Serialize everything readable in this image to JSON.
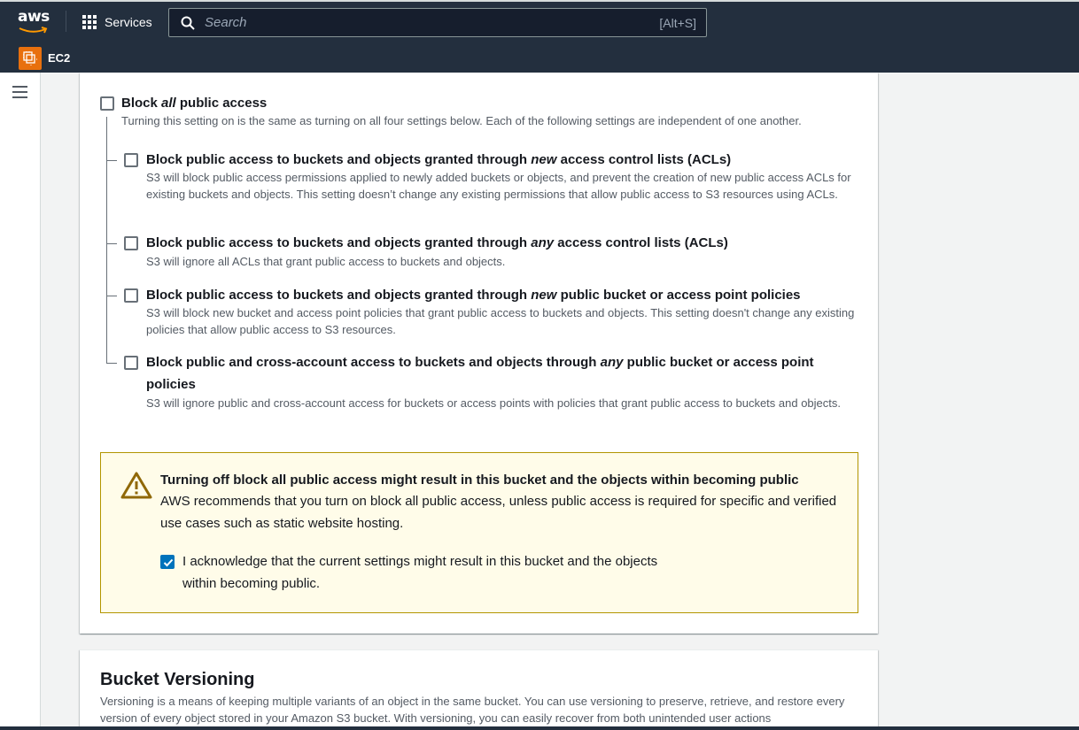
{
  "topbar": {
    "logo_text": "aws",
    "services_label": "Services",
    "search_placeholder": "Search",
    "search_shortcut": "[Alt+S]",
    "service_name": "EC2",
    "colors": {
      "background": "#232f3e",
      "ec2_icon": "#e8700e"
    }
  },
  "block_public_access": {
    "master": {
      "title_prefix": "Block ",
      "title_em": "all",
      "title_suffix": " public access",
      "description": "Turning this setting on is the same as turning on all four settings below. Each of the following settings are independent of one another.",
      "checked": false
    },
    "options": [
      {
        "title_prefix": "Block public access to buckets and objects granted through ",
        "title_em": "new",
        "title_suffix": " access control lists (ACLs)",
        "description": "S3 will block public access permissions applied to newly added buckets or objects, and prevent the creation of new public access ACLs for existing buckets and objects. This setting doesn’t change any existing permissions that allow public access to S3 resources using ACLs.",
        "checked": false
      },
      {
        "title_prefix": "Block public access to buckets and objects granted through ",
        "title_em": "any",
        "title_suffix": " access control lists (ACLs)",
        "description": "S3 will ignore all ACLs that grant public access to buckets and objects.",
        "checked": false
      },
      {
        "title_prefix": "Block public access to buckets and objects granted through ",
        "title_em": "new",
        "title_suffix": " public bucket or access point policies",
        "description": "S3 will block new bucket and access point policies that grant public access to buckets and objects. This setting doesn't change any existing policies that allow public access to S3 resources.",
        "checked": false
      },
      {
        "title_prefix": "Block public and cross-account access to buckets and objects through ",
        "title_em": "any",
        "title_suffix": " public bucket or access point policies",
        "description": "S3 will ignore public and cross-account access for buckets or access points with policies that grant public access to buckets and objects.",
        "checked": false
      }
    ]
  },
  "warning": {
    "title": "Turning off block all public access might result in this bucket and the objects within becoming public",
    "body": "AWS recommends that you turn on block all public access, unless public access is required for specific and verified use cases such as static website hosting.",
    "acknowledge_label": "I acknowledge that the current settings might result in this bucket and the objects within becoming public.",
    "acknowledge_checked": true,
    "colors": {
      "background": "#fffce9",
      "border": "#b29500",
      "icon": "#906806"
    }
  },
  "versioning": {
    "title": "Bucket Versioning",
    "description": "Versioning is a means of keeping multiple variants of an object in the same bucket. You can use versioning to preserve, retrieve, and restore every version of every object stored in your Amazon S3 bucket. With versioning, you can easily recover from both unintended user actions"
  }
}
